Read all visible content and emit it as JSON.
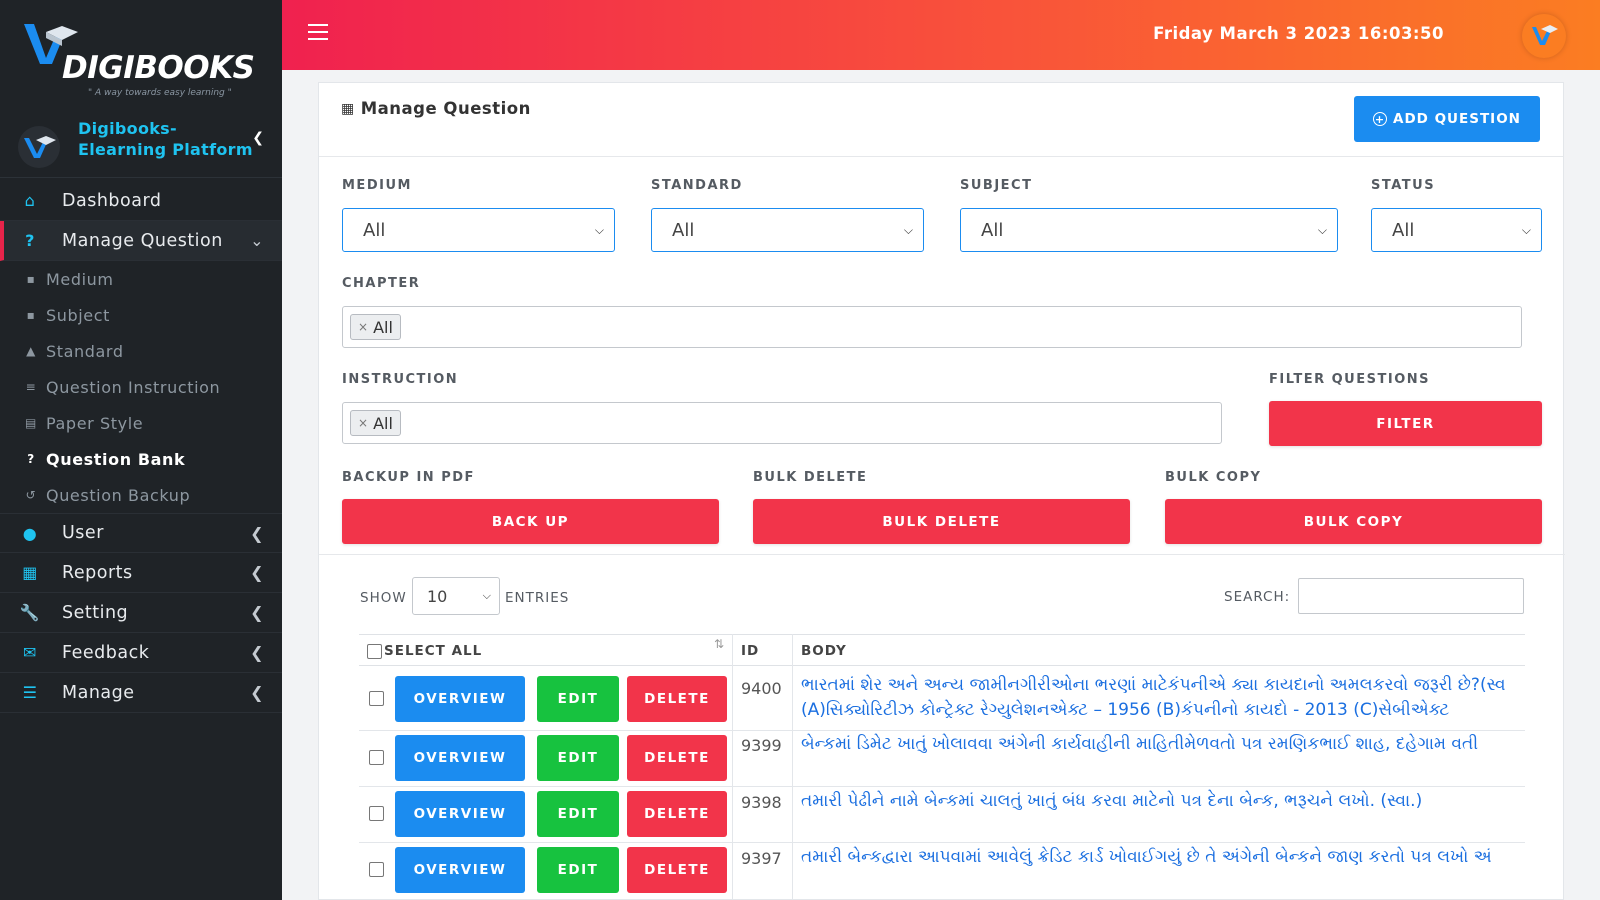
{
  "brand": {
    "logo_text": "DIGIBOOKS",
    "tagline": "\" A way towards easy learning \"",
    "platform_name_line1": "Digibooks-",
    "platform_name_line2": "Elearning Platform"
  },
  "topbar": {
    "datetime": "Friday March 3 2023 16:03:50"
  },
  "sidebar": {
    "items": [
      {
        "label": "Dashboard",
        "icon": "home-icon"
      },
      {
        "label": "Manage Question",
        "icon": "question-icon"
      },
      {
        "label": "User",
        "icon": "users-icon"
      },
      {
        "label": "Reports",
        "icon": "table-icon"
      },
      {
        "label": "Setting",
        "icon": "wrench-icon"
      },
      {
        "label": "Feedback",
        "icon": "envelope-icon"
      },
      {
        "label": "Manage",
        "icon": "list-icon"
      }
    ],
    "subitems": [
      {
        "label": "Medium",
        "icon": "book-icon"
      },
      {
        "label": "Subject",
        "icon": "book-icon"
      },
      {
        "label": "Standard",
        "icon": "graduation-cap-icon"
      },
      {
        "label": "Question Instruction",
        "icon": "list-icon"
      },
      {
        "label": "Paper Style",
        "icon": "newspaper-icon"
      },
      {
        "label": "Question Bank",
        "icon": "question-icon"
      },
      {
        "label": "Question Backup",
        "icon": "undo-icon"
      }
    ]
  },
  "card": {
    "title": "Manage Question",
    "add_button": "ADD QUESTION"
  },
  "filters": {
    "medium_label": "MEDIUM",
    "medium_value": "All",
    "standard_label": "STANDARD",
    "standard_value": "All",
    "subject_label": "SUBJECT",
    "subject_value": "All",
    "status_label": "STATUS",
    "status_value": "All",
    "chapter_label": "CHAPTER",
    "chapter_tag": "All",
    "instruction_label": "INSTRUCTION",
    "instruction_tag": "All",
    "filter_questions_label": "FILTER QUESTIONS",
    "filter_button": "FILTER",
    "backup_label": "BACKUP IN PDF",
    "backup_button": "BACK UP",
    "bulk_delete_label": "BULK DELETE",
    "bulk_delete_button": "BULK DELETE",
    "bulk_copy_label": "BULK COPY",
    "bulk_copy_button": "BULK COPY"
  },
  "table_controls": {
    "show_label": "SHOW",
    "entries_value": "10",
    "entries_label": "ENTRIES",
    "search_label": "SEARCH:",
    "search_value": ""
  },
  "table": {
    "headers": {
      "select_all": "SELECT ALL",
      "id": "ID",
      "body": "BODY"
    },
    "buttons": {
      "overview": "OVERVIEW",
      "edit": "EDIT",
      "delete": "DELETE"
    },
    "rows": [
      {
        "id": "9400",
        "body_line1": "ભારતમાં શેર અને અન્ય જામીનગીરીઓના ભરણાં માટેકંપનીએ ક્યા કાયદાનો અમલકરવો જરૂરી છે?(સ્વ",
        "body_line2": "(A)સિક્યોરિટીઝ કોન્ટ્રેક્ટ રેગ્યુલેશનએક્ટ – 1956    (B)કંપનીનો કાયદો - 2013    (C)સેબીએક્ટ"
      },
      {
        "id": "9399",
        "body_line1": "બેન્કમાં ડિમેટ ખાતું ખોલાવવા અંગેની કાર્યવાહીની માહિતીમેળવતો પત્ર રમણિકભાઈ શાહ, દહેગામ વતી",
        "body_line2": ""
      },
      {
        "id": "9398",
        "body_line1": "તમારી પેઢીને નામે બેન્કમાં ચાલતું ખાતું બંધ કરવા માટેનો પત્ર દેના બેન્ક, ભરૂચને લખો. (સ્વા.)",
        "body_line2": ""
      },
      {
        "id": "9397",
        "body_line1": "તમારી બેન્કદ્વારા આપવામાં આવેલું ક્રેડિટ કાર્ડ ખોવાઈગયું છે તે અંગેની બેન્કને જાણ કરતો પત્ર લખો અં",
        "body_line2": ""
      }
    ]
  },
  "colors": {
    "accent_blue": "#1b8cf0",
    "accent_red": "#f2344a",
    "accent_green": "#17c23f",
    "sidebar_bg": "#1f2327",
    "cyan": "#1fc3f0"
  }
}
